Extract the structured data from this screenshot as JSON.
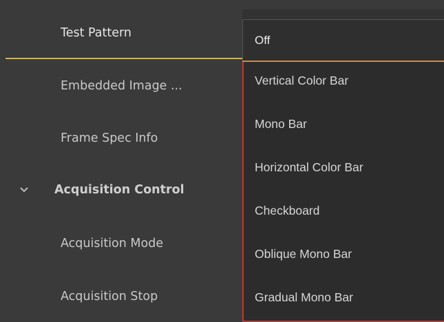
{
  "property_tree": {
    "rows": [
      {
        "label": "Test Pattern",
        "selected": true
      },
      {
        "label": "Embedded Image ..."
      },
      {
        "label": "Frame Spec Info"
      },
      {
        "label": "Acquisition Control",
        "category": true,
        "expanded": true
      },
      {
        "label": "Acquisition Mode"
      },
      {
        "label": "Acquisition Stop"
      }
    ]
  },
  "test_pattern_combo": {
    "value": "Off",
    "options": [
      "Vertical Color Bar",
      "Mono Bar",
      "Horizontal Color Bar",
      "Checkboard",
      "Oblique Mono Bar",
      "Gradual Mono Bar"
    ]
  },
  "colors": {
    "background": "#3a3a3a",
    "selection_underline": "#c7b56a",
    "combo_focus": "#e08a2e",
    "dropdown_border": "#c8342b"
  },
  "icons": {
    "category_toggle": "chevron-down-icon"
  }
}
